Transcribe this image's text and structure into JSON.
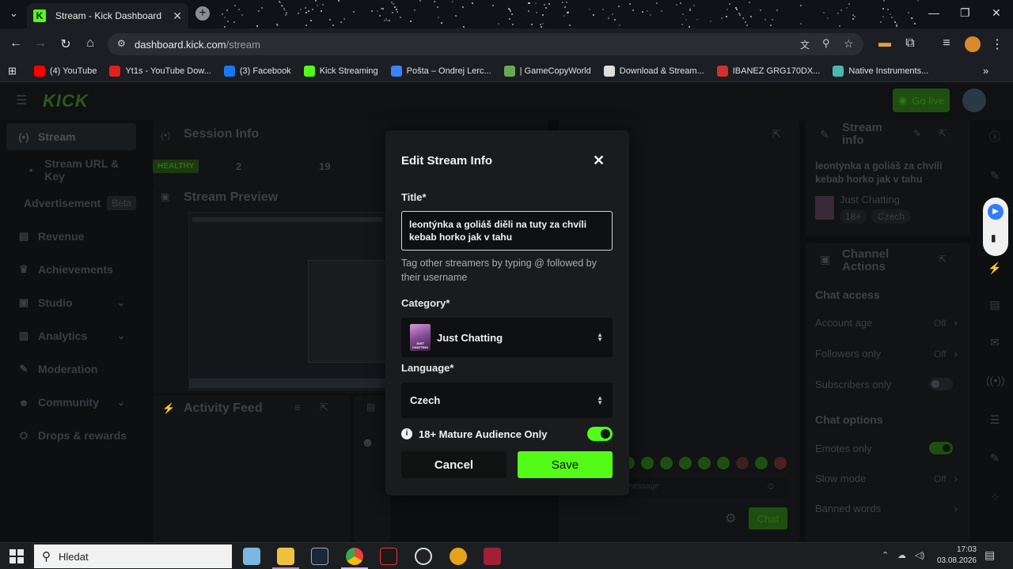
{
  "browser": {
    "tab": {
      "title": "Stream - Kick Dashboard",
      "favicon": "K"
    },
    "url": {
      "host": "dashboard.kick.com",
      "path": "/stream"
    },
    "bookmarks": [
      {
        "label": "(4) YouTube",
        "color": "#ff0000"
      },
      {
        "label": "Yt1s - YouTube Dow...",
        "color": "#e02020"
      },
      {
        "label": "(3) Facebook",
        "color": "#1877f2"
      },
      {
        "label": "Kick Streaming",
        "color": "#53fc18"
      },
      {
        "label": "Pošta – Ondrej Lerc...",
        "color": "#3b82f6"
      },
      {
        "label": "| GameCopyWorld",
        "color": "#6aa84f"
      },
      {
        "label": "Download & Stream...",
        "color": "#dddddd"
      },
      {
        "label": "IBANEZ GRG170DX...",
        "color": "#d32f2f"
      },
      {
        "label": "Native Instruments...",
        "color": "#4db6ac"
      }
    ]
  },
  "kick": {
    "logo": "KICK",
    "go_live": "Go live",
    "nav": [
      {
        "label": "Stream",
        "icon": "broadcast-icon",
        "glyph": "(•)"
      },
      {
        "label": "Stream URL & Key",
        "icon": "",
        "glyph": "•"
      },
      {
        "label": "Advertisement",
        "icon": "",
        "glyph": "",
        "badge": "Beta"
      },
      {
        "label": "Revenue",
        "icon": "revenue-icon",
        "glyph": "▤"
      },
      {
        "label": "Achievements",
        "icon": "trophy-icon",
        "glyph": "♛"
      },
      {
        "label": "Studio",
        "icon": "studio-icon",
        "glyph": "▣"
      },
      {
        "label": "Analytics",
        "icon": "analytics-icon",
        "glyph": "▥"
      },
      {
        "label": "Moderation",
        "icon": "wrench-icon",
        "glyph": "✎"
      },
      {
        "label": "Community",
        "icon": "community-icon",
        "glyph": "☻"
      },
      {
        "label": "Drops & rewards",
        "icon": "drops-icon",
        "glyph": "⛭"
      }
    ],
    "session": {
      "title": "Session Info",
      "status": "HEALTHY",
      "stat1": "2",
      "stat2": "19"
    },
    "preview_title": "Stream Preview",
    "activity_title": "Activity Feed",
    "chat": {
      "send": "Chat",
      "placeholder": "message"
    },
    "stream_info": {
      "title": "Stream info",
      "stream_title": "leontýnka a goliáš za chvíli kebab horko jak v tahu",
      "category": "Just Chatting",
      "tags": [
        "18+",
        "Czech"
      ]
    },
    "channel_actions": {
      "title": "Channel Actions",
      "chat_access": "Chat access",
      "account_age": {
        "label": "Account age",
        "value": "Off"
      },
      "followers_only": {
        "label": "Followers only",
        "value": "Off"
      },
      "subscribers_only": {
        "label": "Subscribers only"
      },
      "chat_options": "Chat options",
      "emotes_only": {
        "label": "Emotes only"
      },
      "slow_mode": {
        "label": "Slow mode",
        "value": "Off"
      },
      "banned_words": {
        "label": "Banned words"
      }
    }
  },
  "modal": {
    "title": "Edit Stream Info",
    "title_label": "Title*",
    "title_value": "leontýnka a goliáš diěli na tuty za chvíli kebab horko jak v tahu",
    "hint": "Tag other streamers by typing @ followed by their username",
    "category_label": "Category*",
    "category_value": "Just Chatting",
    "category_thumb_text": "JUST CHATTING",
    "language_label": "Language*",
    "language_value": "Czech",
    "mature_label": "18+ Mature Audience Only",
    "mature_enabled": true,
    "cancel": "Cancel",
    "save": "Save",
    "accent": "#53fc18"
  },
  "taskbar": {
    "search_placeholder": "Hledat",
    "time": "17:03",
    "date": "03.08.2026"
  }
}
